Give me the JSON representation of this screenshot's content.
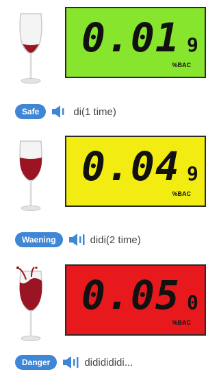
{
  "levels": [
    {
      "reading": "0.01",
      "suffix": "9",
      "unit": "%BAC",
      "badge": "Safe",
      "sound": "di(1 time)",
      "lcd_color": "#86e52c",
      "wine_fill": 0.1
    },
    {
      "reading": "0.04",
      "suffix": "9",
      "unit": "%BAC",
      "badge": "Waening",
      "sound": "didi(2 time)",
      "lcd_color": "#f2ec12",
      "wine_fill": 0.5
    },
    {
      "reading": "0.05",
      "suffix": "0",
      "unit": "%BAC",
      "badge": "Danger",
      "sound": "dididididi...",
      "lcd_color": "#e8191c",
      "wine_fill": 0.8
    }
  ],
  "icons": {
    "glass": "wine-glass-icon",
    "speaker": "speaker-icon"
  },
  "colors": {
    "badge": "#3f86d6",
    "wine": "#9b1424"
  }
}
